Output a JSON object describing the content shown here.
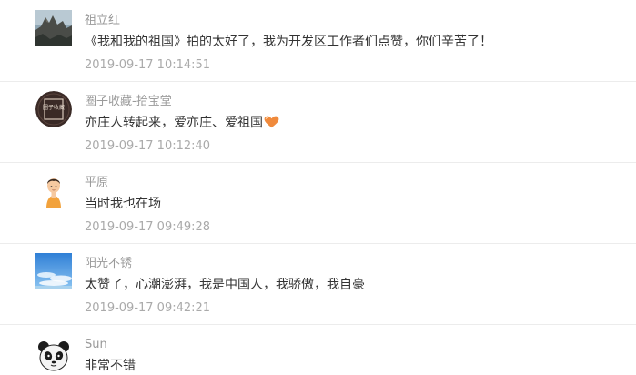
{
  "comments": [
    {
      "username": "祖立红",
      "content": "《我和我的祖国》拍的太好了，我为开发区工作者们点赞，你们辛苦了！",
      "timestamp": "2019-09-17 10:14:51",
      "avatar_icon": "mountain-photo-icon"
    },
    {
      "username": "圈子收藏-拾宝堂",
      "content": "亦庄人转起来，爱亦庄、爱祖国",
      "timestamp": "2019-09-17 10:12:40",
      "avatar_icon": "collection-badge-icon",
      "avatar_text": "圈子收藏",
      "emoji": "heart-emoji-icon"
    },
    {
      "username": "平原",
      "content": "当时我也在场",
      "timestamp": "2019-09-17 09:49:28",
      "avatar_icon": "cartoon-person-icon"
    },
    {
      "username": "阳光不锈",
      "content": "太赞了，心潮澎湃，我是中国人，我骄傲，我自豪",
      "timestamp": "2019-09-17 09:42:21",
      "avatar_icon": "sky-photo-icon"
    },
    {
      "username": "Sun",
      "content": "非常不错",
      "timestamp": "",
      "avatar_icon": "panda-icon"
    }
  ],
  "colors": {
    "username": "#9a9a9a",
    "content": "#333333",
    "timestamp": "#aaaaaa",
    "divider": "#ececec",
    "heart": "#f08a3c"
  }
}
